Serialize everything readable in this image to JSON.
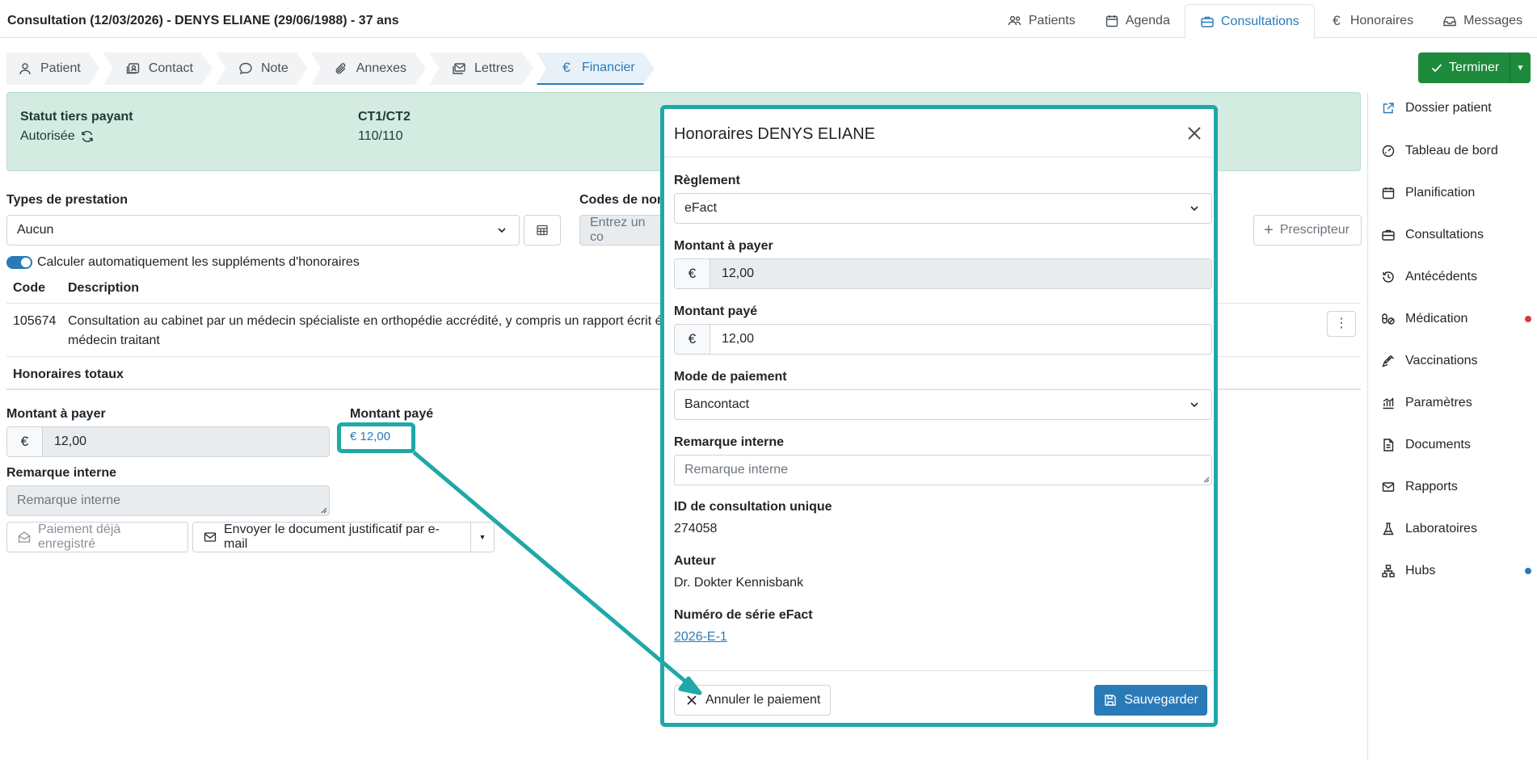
{
  "header": {
    "title": "Consultation (12/03/2026) - DENYS ELIANE (29/06/1988) - 37 ans",
    "nav": [
      {
        "label": "Patients",
        "icon": "users-icon"
      },
      {
        "label": "Agenda",
        "icon": "calendar-icon"
      },
      {
        "label": "Consultations",
        "icon": "briefcase-icon",
        "active": true
      },
      {
        "label": "Honoraires",
        "icon": "euro-icon"
      },
      {
        "label": "Messages",
        "icon": "inbox-icon"
      }
    ]
  },
  "subtabs": [
    {
      "label": "Patient",
      "icon": "person-icon"
    },
    {
      "label": "Contact",
      "icon": "contact-card-icon"
    },
    {
      "label": "Note",
      "icon": "chat-icon"
    },
    {
      "label": "Annexes",
      "icon": "paperclip-icon"
    },
    {
      "label": "Lettres",
      "icon": "letters-icon"
    },
    {
      "label": "Financier",
      "icon": "euro-icon",
      "active": true
    }
  ],
  "finish_button": {
    "label": "Terminer"
  },
  "status": {
    "tiers_label": "Statut tiers payant",
    "tiers_value": "Autorisée",
    "ct_label": "CT1/CT2",
    "ct_value": "110/110",
    "color": "#d4ebe2"
  },
  "prestation": {
    "label": "Types de prestation",
    "value": "Aucun",
    "codes_label": "Codes de nom",
    "codes_placeholder": "Entrez un co",
    "prescriber_label": "Prescripteur"
  },
  "auto_supplements": {
    "label": "Calculer automatiquement les suppléments d'honoraires",
    "checked": true
  },
  "table": {
    "headers": [
      "Code",
      "Description"
    ],
    "rows": [
      {
        "code": "105674",
        "description_line1": "Consultation au cabinet par un médecin spécialiste en orthopédie accrédité, y compris un rapport écrit é",
        "description_line2": "médecin traitant"
      }
    ],
    "totals_label": "Honoraires totaux"
  },
  "amounts": {
    "to_pay_label": "Montant à payer",
    "currency": "€",
    "to_pay_value": "12,00",
    "paid_label": "Montant payé",
    "paid_value": "€ 12,00",
    "remark_label": "Remarque interne",
    "remark_placeholder": "Remarque interne"
  },
  "actions": {
    "already_paid": "Paiement déjà enregistré",
    "send_email": "Envoyer le document justificatif par e-mail"
  },
  "sidebar": [
    {
      "label": "Dossier patient",
      "icon": "external-link-icon"
    },
    {
      "label": "Tableau de bord",
      "icon": "gauge-icon"
    },
    {
      "label": "Planification",
      "icon": "calendar-icon"
    },
    {
      "label": "Consultations",
      "icon": "briefcase-icon"
    },
    {
      "label": "Antécédents",
      "icon": "history-icon"
    },
    {
      "label": "Médication",
      "icon": "pills-icon",
      "dot": "#dc3545"
    },
    {
      "label": "Vaccinations",
      "icon": "syringe-icon"
    },
    {
      "label": "Paramètres",
      "icon": "chart-icon"
    },
    {
      "label": "Documents",
      "icon": "document-icon"
    },
    {
      "label": "Rapports",
      "icon": "mail-icon"
    },
    {
      "label": "Laboratoires",
      "icon": "flask-icon"
    },
    {
      "label": "Hubs",
      "icon": "network-icon",
      "dot": "#2a7ab8"
    }
  ],
  "modal": {
    "title": "Honoraires DENYS ELIANE",
    "reglement_label": "Règlement",
    "reglement_value": "eFact",
    "to_pay_label": "Montant à payer",
    "currency": "€",
    "to_pay_value": "12,00",
    "paid_label": "Montant payé",
    "paid_value": "12,00",
    "mode_label": "Mode de paiement",
    "mode_value": "Bancontact",
    "remark_label": "Remarque interne",
    "remark_placeholder": "Remarque interne",
    "id_label": "ID de consultation unique",
    "id_value": "274058",
    "author_label": "Auteur",
    "author_value": "Dr. Dokter Kennisbank",
    "serial_label": "Numéro de série eFact",
    "serial_value": "2026-E-1",
    "cancel_label": "Annuler le paiement",
    "save_label": "Sauvegarder"
  },
  "highlight_color": "#20a8a8"
}
